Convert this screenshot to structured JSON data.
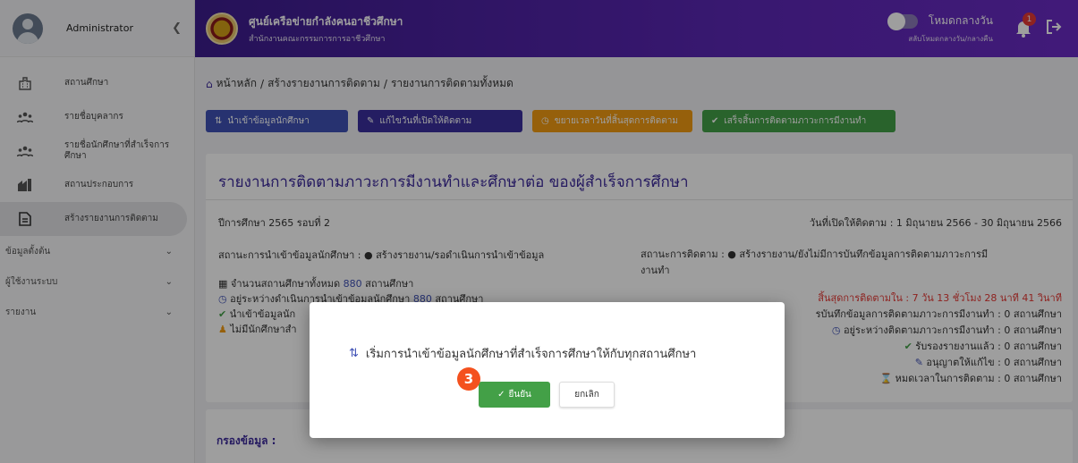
{
  "sidebar": {
    "user": "Administrator",
    "items": [
      {
        "label": "สถานศึกษา",
        "icon": "building-icon"
      },
      {
        "label": "รายชื่อบุคลากร",
        "icon": "people-icon"
      },
      {
        "label": "รายชื่อนักศึกษาที่สำเร็จการศึกษา",
        "icon": "people-icon"
      },
      {
        "label": "สถานประกอบการ",
        "icon": "factory-icon"
      },
      {
        "label": "สร้างรายงานการติดตาม",
        "icon": "report-icon"
      }
    ],
    "sections": [
      "ข้อมูลตั้งต้น",
      "ผู้ใช้งานระบบ",
      "รายงาน"
    ]
  },
  "topbar": {
    "title": "ศูนย์เครือข่ายกำลังคนอาชีวศึกษา",
    "subtitle": "สำนักงานคณะกรรมการการอาชีวศึกษา",
    "night_label": "โหมดกลางวัน",
    "night_sub": "สลับโหมดกลางวัน/กลางคืน",
    "notif_count": "1"
  },
  "breadcrumb": [
    "หน้าหลัก",
    "สร้างรายงานการติดตาม",
    "รายงานการติดตามทั้งหมด"
  ],
  "toolbar": {
    "import": "นำเข้าข้อมูลนักศึกษา",
    "edit": "แก้ไขวันที่เปิดให้ติดตาม",
    "extend": "ขยายเวลาวันที่สิ้นสุดการติดตาม",
    "done": "เสร็จสิ้นการติดตามภาวะการมีงานทำ"
  },
  "card": {
    "title": "รายงานการติดตามภาวะการมีงานทำและศึกษาต่อ ของผู้สำเร็จการศึกษา",
    "year": "ปีการศึกษา 2565 รอบที่ 2",
    "open_range": "วันที่เปิดให้ติดตาม : 1 มิถุนายน 2566 - 30 มิถุนายน 2566",
    "import_status": "สถานะการนำเข้าข้อมูลนักศึกษา :",
    "import_status_val": "สร้างรายงาน/รอดำเนินการนำเข้าข้อมูล",
    "track_status": "สถานะการติดตาม :",
    "track_status_val": "สร้างรายงาน/ยังไม่มีการบันทึกข้อมูลการติดตามภาวะการมี",
    "track_status_val2": "งานทำ",
    "total_label": "จำนวนสถานศึกษาทั้งหมด",
    "total_num": "880",
    "unit": "สถานศึกษา",
    "importing_label": "อยู่ระหว่างดำเนินการนำเข้าข้อมูลนักศึกษา",
    "importing_num": "880",
    "imported_label": "นำเข้าข้อมูลนัก",
    "no_students_label": "ไม่มีนักศึกษาสำ",
    "countdown": "สิ้นสุดการติดตามใน : 7 วัน 13 ชั่วโมง 28 นาที 41 วินาที",
    "r1": "รบันทึกข้อมูลการติดตามภาวะการมีงานทำ : 0 สถานศึกษา",
    "r2": "อยู่ระหว่างติดตามภาวะการมีงานทำ : 0 สถานศึกษา",
    "r3": "รับรองรายงานแล้ว : 0 สถานศึกษา",
    "r4": "อนุญาตให้แก้ไข : 0 สถานศึกษา",
    "r5": "หมดเวลาในการติดตาม : 0 สถานศึกษา"
  },
  "filter": {
    "label": "กรองข้อมูล :"
  },
  "modal": {
    "message": "เริ่มการนำเข้าข้อมูลนักศึกษาที่สำเร็จการศึกษาให้กับทุกสถานศึกษา",
    "confirm": "ยืนยัน",
    "cancel": "ยกเลิก",
    "step": "3"
  }
}
